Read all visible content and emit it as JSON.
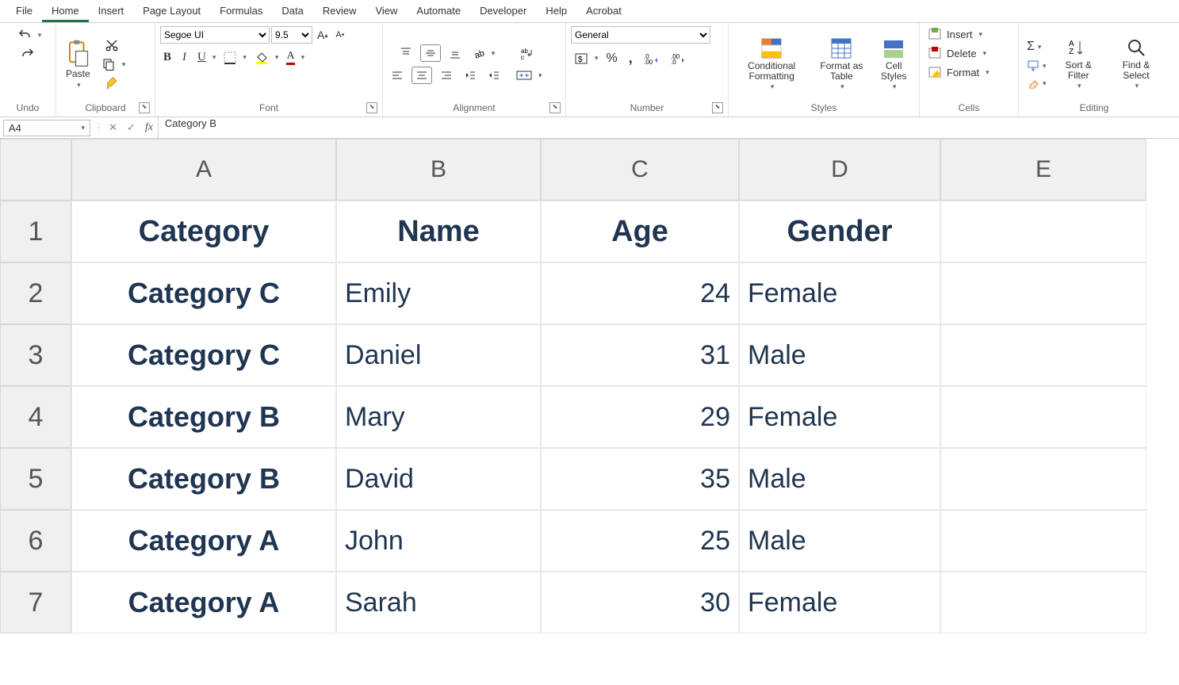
{
  "menu": {
    "items": [
      "File",
      "Home",
      "Insert",
      "Page Layout",
      "Formulas",
      "Data",
      "Review",
      "View",
      "Automate",
      "Developer",
      "Help",
      "Acrobat"
    ],
    "active": 1
  },
  "ribbon": {
    "undo_label": "Undo",
    "clipboard_label": "Clipboard",
    "paste_label": "Paste",
    "font_label": "Font",
    "font_name": "Segoe UI",
    "font_size": "9.5",
    "alignment_label": "Alignment",
    "number_label": "Number",
    "number_format": "General",
    "styles_label": "Styles",
    "cond_fmt": "Conditional Formatting",
    "fmt_table": "Format as Table",
    "cell_styles": "Cell Styles",
    "cells_label": "Cells",
    "insert": "Insert",
    "delete": "Delete",
    "format": "Format",
    "editing_label": "Editing",
    "sort_filter": "Sort & Filter",
    "find_select": "Find & Select"
  },
  "formula_bar": {
    "cell_ref": "A4",
    "value": "Category B"
  },
  "sheet": {
    "columns": [
      "A",
      "B",
      "C",
      "D",
      "E"
    ],
    "rows": [
      "1",
      "2",
      "3",
      "4",
      "5",
      "6",
      "7"
    ],
    "headers": [
      "Category",
      "Name",
      "Age",
      "Gender"
    ],
    "data": [
      {
        "category": "Category C",
        "name": "Emily",
        "age": "24",
        "gender": "Female"
      },
      {
        "category": "Category C",
        "name": "Daniel",
        "age": "31",
        "gender": "Male"
      },
      {
        "category": "Category B",
        "name": "Mary",
        "age": "29",
        "gender": "Female"
      },
      {
        "category": "Category B",
        "name": "David",
        "age": "35",
        "gender": "Male"
      },
      {
        "category": "Category A",
        "name": "John",
        "age": "25",
        "gender": "Male"
      },
      {
        "category": "Category A",
        "name": "Sarah",
        "age": "30",
        "gender": "Female"
      }
    ]
  }
}
